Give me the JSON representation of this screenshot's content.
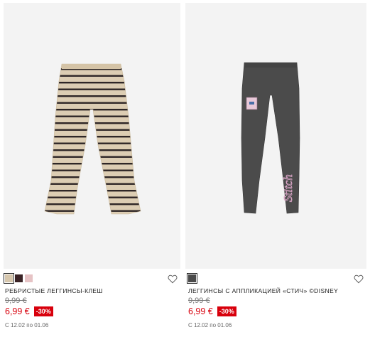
{
  "products": [
    {
      "title": "РЕБРИСТЫЕ ЛЕГГИНСЫ-КЛЕШ",
      "old_price": "9,99 €",
      "new_price": "6,99 €",
      "discount": "-30%",
      "date_range": "С 12.02 по 01.06",
      "swatches": [
        "#d7c7ad",
        "#3a2326",
        "#e6c3c5"
      ],
      "selected_swatch": 0,
      "image": "striped-flare-leggings"
    },
    {
      "title": "ЛЕГГИНСЫ С АППЛИКАЦИЕЙ «СТИЧ» ©DISNEY",
      "old_price": "9,99 €",
      "new_price": "6,99 €",
      "discount": "-30%",
      "date_range": "С 12.02 по 01.06",
      "swatches": [
        "#4a4a4a"
      ],
      "selected_swatch": 0,
      "image": "grey-stitch-leggings"
    }
  ],
  "colors": {
    "sale_red": "#d8000c",
    "image_bg": "#f3f3f3"
  }
}
